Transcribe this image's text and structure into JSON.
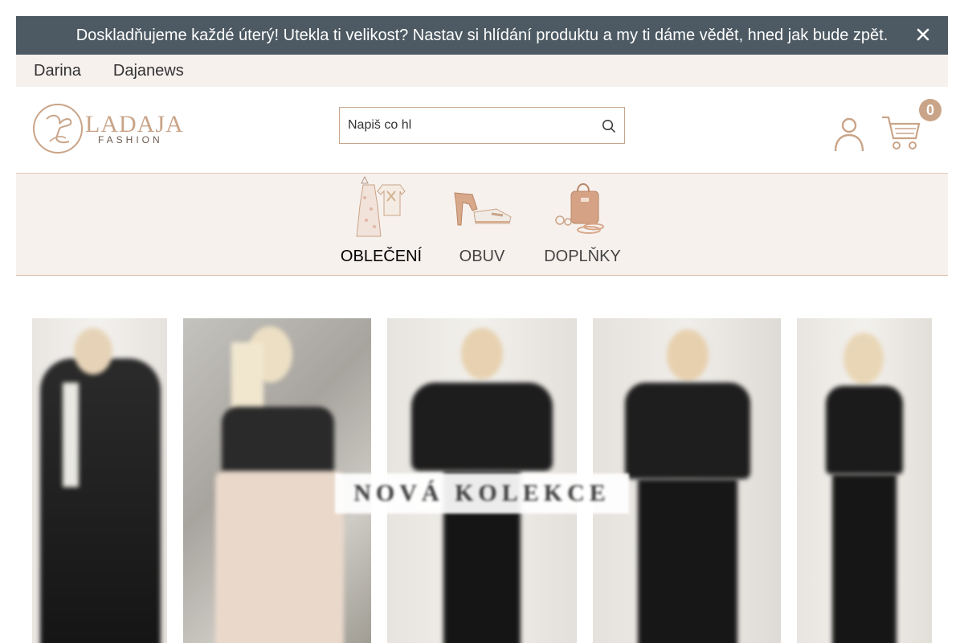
{
  "announcement": {
    "text": "Doskladňujeme každé úterý! Utekla ti velikost? Nastav si hlídání produktu a my ti dáme vědět, hned jak bude zpět.",
    "close_icon": "close-icon"
  },
  "topnav": {
    "items": [
      {
        "label": "Darina"
      },
      {
        "label": "Dajanews"
      }
    ]
  },
  "header": {
    "logo": {
      "name": "LADAJA",
      "sub": "FASHION"
    },
    "search": {
      "value": "Napiš co hl",
      "icon": "search-icon"
    },
    "cart_count": "0"
  },
  "categories": [
    {
      "label": "OBLEČENÍ",
      "active": true
    },
    {
      "label": "OBUV",
      "active": false
    },
    {
      "label": "DOPLŇKY",
      "active": false
    }
  ],
  "hero": {
    "banner_text": "NOVÁ KOLEKCE"
  },
  "colors": {
    "announce_bg": "#4d5a63",
    "accent": "#c9a488",
    "nav_bg": "#f7f1ee"
  }
}
